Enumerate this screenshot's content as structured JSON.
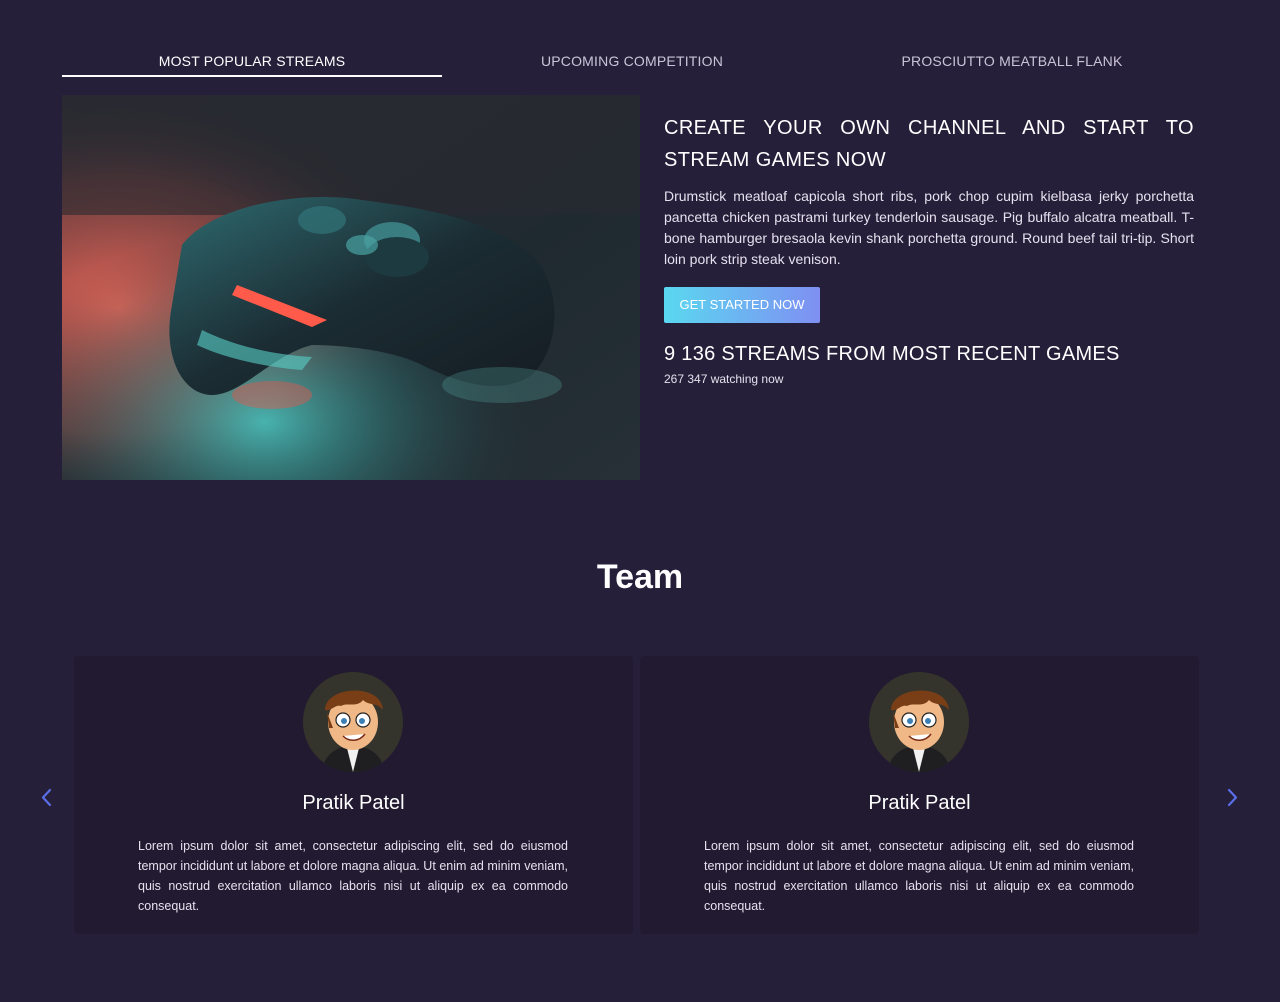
{
  "tabs": [
    {
      "label": "MOST POPULAR STREAMS",
      "active": true
    },
    {
      "label": "UPCOMING COMPETITION",
      "active": false
    },
    {
      "label": "PROSCIUTTO MEATBALL FLANK",
      "active": false
    }
  ],
  "hero": {
    "heading": "CREATE YOUR OWN CHANNEL AND START TO STREAM GAMES NOW",
    "description": "Drumstick meatloaf capicola short ribs, pork chop cupim kielbasa jerky porchetta pancetta chicken pastrami turkey tenderloin sausage. Pig buffalo alcatra meatball. T-bone hamburger bresaola kevin shank porchetta ground. Round beef tail tri-tip. Short loin pork strip steak venison.",
    "cta_label": "GET STARTED NOW",
    "stat_heading": "9 136 STREAMS FROM MOST RECENT GAMES",
    "stat_sub": "267 347 watching now",
    "image_icon": "game-controller-photo"
  },
  "team": {
    "title": "Team",
    "members": [
      {
        "name": "Pratik Patel",
        "bio": "Lorem ipsum dolor sit amet, consectetur adipiscing elit, sed do eiusmod tempor incididunt ut labore et dolore magna aliqua. Ut enim ad minim veniam, quis nostrud exercitation ullamco laboris nisi ut aliquip ex ea commodo consequat.",
        "avatar_icon": "cartoon-avatar"
      },
      {
        "name": "Pratik Patel",
        "bio": "Lorem ipsum dolor sit amet, consectetur adipiscing elit, sed do eiusmod tempor incididunt ut labore et dolore magna aliqua. Ut enim ad minim veniam, quis nostrud exercitation ullamco laboris nisi ut aliquip ex ea commodo consequat.",
        "avatar_icon": "cartoon-avatar"
      }
    ],
    "prev_icon": "chevron-left-icon",
    "next_icon": "chevron-right-icon"
  },
  "colors": {
    "background": "#261f3a",
    "card": "#211a31",
    "accent_start": "#5ad8f0",
    "accent_end": "#7f8ff2",
    "arrow": "#5a6ee8"
  }
}
